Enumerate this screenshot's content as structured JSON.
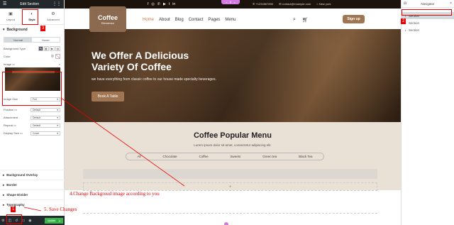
{
  "panel": {
    "title": "Edit Section",
    "tabs": [
      {
        "label": "Layout",
        "icon": "layout-icon"
      },
      {
        "label": "Style",
        "icon": "style-icon"
      },
      {
        "label": "Advanced",
        "icon": "gear-icon"
      }
    ],
    "background_heading": "Background",
    "state_tabs": [
      "Normal",
      "Hover"
    ],
    "background_type_label": "Background Type",
    "color_label": "Color",
    "image_label": "Image",
    "image_size": {
      "label": "Image Size",
      "value": "Full"
    },
    "position": {
      "label": "Position",
      "value": "Default"
    },
    "attachment": {
      "label": "Attachment",
      "value": "Default"
    },
    "repeat": {
      "label": "Repeat",
      "value": "Default"
    },
    "display_size": {
      "label": "Display Size",
      "value": "Cover"
    },
    "sections": [
      "Background Overlay",
      "Border",
      "Shape Divider",
      "Typography"
    ],
    "update_label": "Update"
  },
  "site": {
    "contact_phone": "+1234567890",
    "contact_email": "contact@example.com",
    "contact_address": "New york",
    "logo_title": "Coffee",
    "logo_sub": "Elementor",
    "menu": [
      "Home",
      "About",
      "Blog",
      "Contact",
      "Pages",
      "Menu"
    ],
    "signup_label": "Sign up",
    "hero_title_line1": "We Offer A Delicious",
    "hero_title_line2": "Variety Of Coffee",
    "hero_subtitle": "we have everything from classic coffee to our house made specialty beverages.",
    "hero_button": "Book A Table",
    "popular_title": "Coffee Popular Menu",
    "popular_sub": "Lorem ipsum dolor sit amet, consectetur adipiscing elit.",
    "categories": [
      "All",
      "Chocolate",
      "Coffee",
      "Sweets",
      "Green tea",
      "Black Tea"
    ],
    "add_symbol": "+"
  },
  "navigator": {
    "title": "Navigator",
    "items": [
      "Section",
      "Section",
      "Section"
    ]
  },
  "annotations": {
    "step1": "1",
    "step2": "2",
    "step3": "3",
    "step4": "4.Change Backgroud image according to you",
    "step5": "5. Save Changes",
    "color": "#e00000"
  },
  "colors": {
    "accent": "#a07652",
    "editor_dark": "#23282d",
    "editor_pink": "#d37be0"
  }
}
